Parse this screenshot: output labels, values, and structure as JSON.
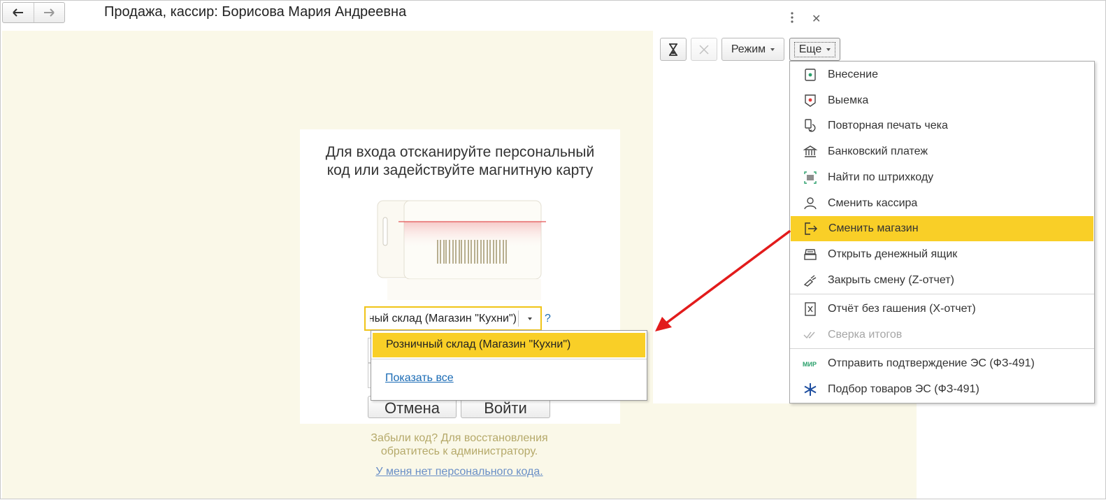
{
  "window": {
    "title": "Продажа, кассир: Борисова Мария Андреевна"
  },
  "toolbar": {
    "mode_label": "Режим",
    "more_label": "Еще"
  },
  "login_dialog": {
    "prompt_line1": "Для входа отсканируйте персональный",
    "prompt_line2": "код или задействуйте магнитную карту",
    "warehouse_value": "Розничный склад (Магазин \"Кухни\")",
    "help_symbol": "?",
    "cancel_label": "Отмена",
    "login_label": "Войти",
    "forgot_line1": "Забыли код? Для восстановления",
    "forgot_line2": "обратитесь к администратору.",
    "no_code_link": "У меня нет персонального кода."
  },
  "warehouse_dropdown": {
    "options": [
      "Розничный склад (Магазин \"Кухни\")"
    ],
    "show_all": "Показать все"
  },
  "more_menu": {
    "items": [
      {
        "label": "Внесение",
        "icon": "cash-in-icon"
      },
      {
        "label": "Выемка",
        "icon": "cash-out-icon"
      },
      {
        "label": "Повторная печать чека",
        "icon": "reprint-receipt-icon"
      },
      {
        "label": "Банковский платеж",
        "icon": "bank-icon"
      },
      {
        "label": "Найти по штрихкоду",
        "icon": "barcode-scan-icon"
      },
      {
        "label": "Сменить кассира",
        "icon": "cashier-icon"
      },
      {
        "label": "Сменить магазин",
        "icon": "exit-store-icon",
        "active": true
      },
      {
        "label": "Открыть денежный ящик",
        "icon": "cash-drawer-icon"
      },
      {
        "label": "Закрыть смену (Z-отчет)",
        "icon": "close-shift-icon"
      },
      {
        "label": "Отчёт без гашения (X-отчет)",
        "icon": "x-report-icon"
      },
      {
        "label": "Сверка итогов",
        "icon": "reconcile-icon",
        "disabled": true
      },
      {
        "label": "Отправить подтверждение ЭС (ФЗ-491)",
        "icon": "mir-icon"
      },
      {
        "label": "Подбор товаров ЭС (ФЗ-491)",
        "icon": "snowflake-icon"
      }
    ]
  },
  "colors": {
    "highlight": "#f9cf27",
    "cream_background": "#faf8e8",
    "link": "#1a6bb5",
    "annotation_arrow": "#e21b1b"
  }
}
